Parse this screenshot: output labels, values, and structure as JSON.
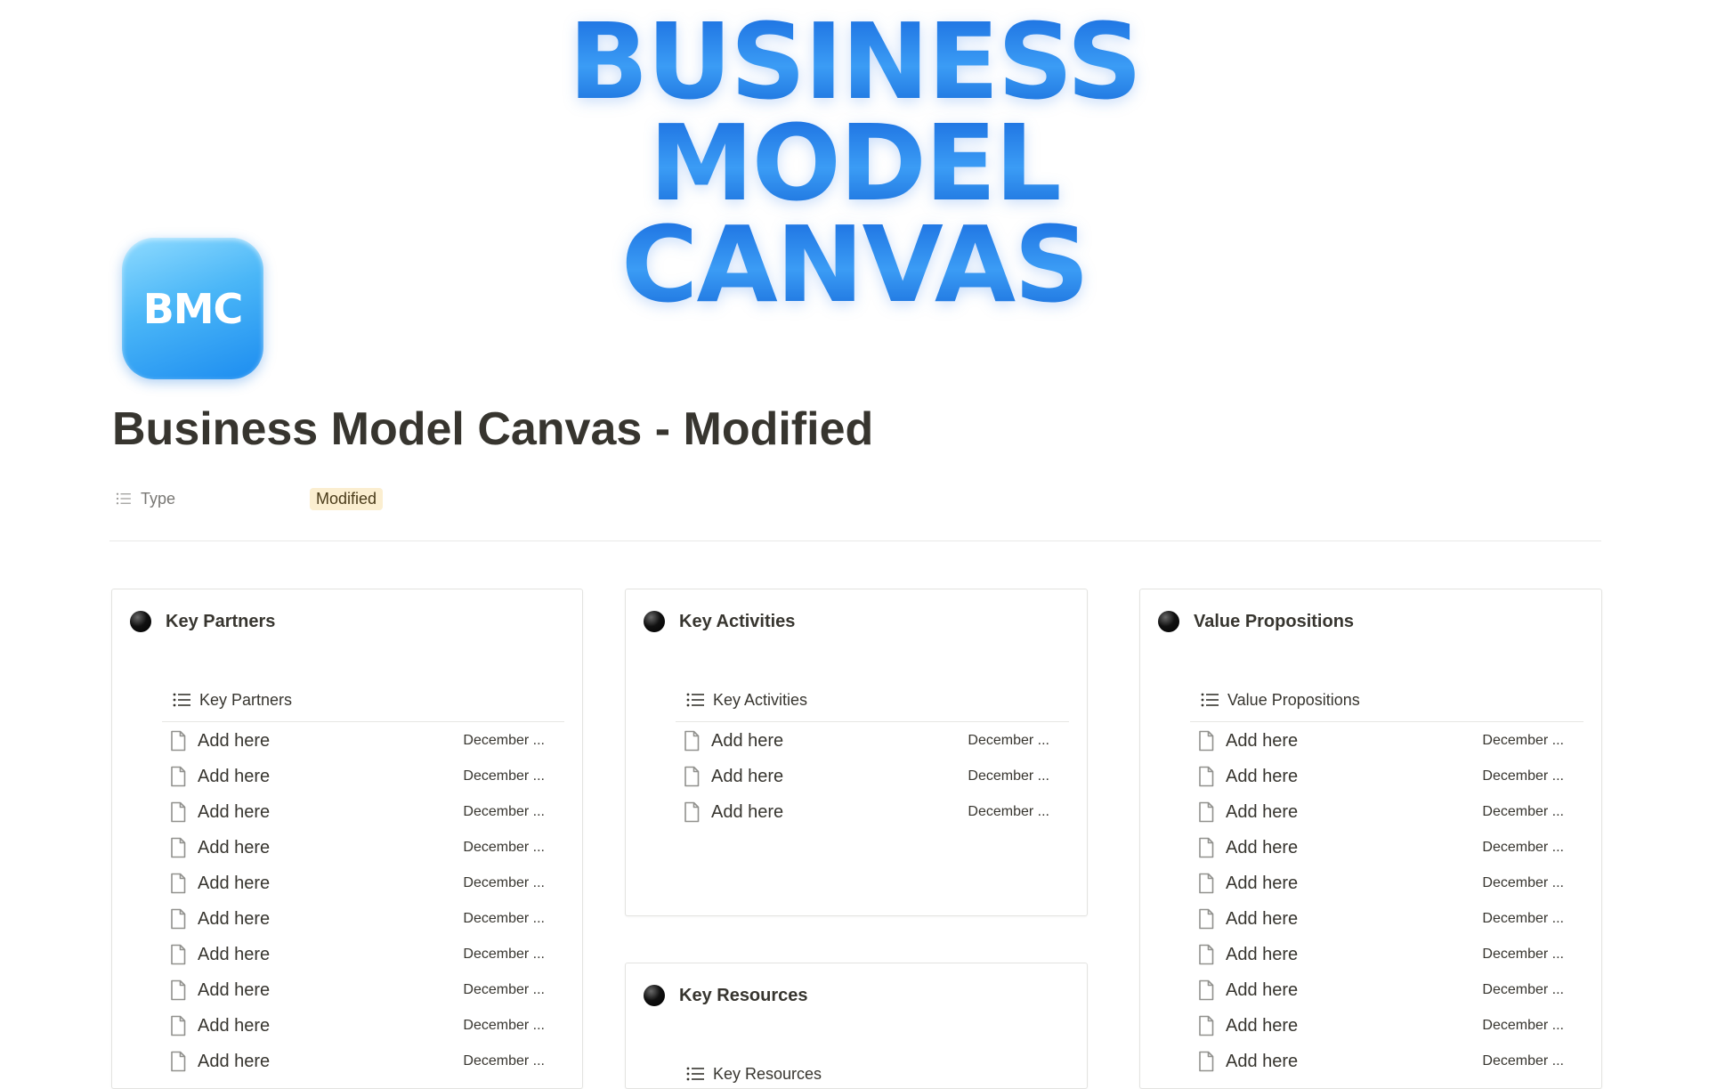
{
  "banner": {
    "lines": [
      "BUSINESS",
      "MODEL",
      "CANVAS"
    ]
  },
  "page_icon": {
    "text": "BMC",
    "icon": "bmc-app-icon"
  },
  "page": {
    "title": "Business Model Canvas - Modified",
    "property": {
      "label": "Type",
      "icon": "list-icon",
      "value": "Modified",
      "tag_color": "#fbeed0"
    }
  },
  "cards": {
    "key_partners": {
      "title": "Key Partners",
      "view": "Key Partners",
      "rows": [
        {
          "title": "Add here",
          "date": "December ..."
        },
        {
          "title": "Add here",
          "date": "December ..."
        },
        {
          "title": "Add here",
          "date": "December ..."
        },
        {
          "title": "Add here",
          "date": "December ..."
        },
        {
          "title": "Add here",
          "date": "December ..."
        },
        {
          "title": "Add here",
          "date": "December ..."
        },
        {
          "title": "Add here",
          "date": "December ..."
        },
        {
          "title": "Add here",
          "date": "December ..."
        },
        {
          "title": "Add here",
          "date": "December ..."
        },
        {
          "title": "Add here",
          "date": "December ..."
        }
      ]
    },
    "key_activities": {
      "title": "Key Activities",
      "view": "Key Activities",
      "rows": [
        {
          "title": "Add here",
          "date": "December ..."
        },
        {
          "title": "Add here",
          "date": "December ..."
        },
        {
          "title": "Add here",
          "date": "December ..."
        }
      ]
    },
    "key_resources": {
      "title": "Key Resources",
      "view": "Key Resources"
    },
    "value_propositions": {
      "title": "Value Propositions",
      "view": "Value Propositions",
      "rows": [
        {
          "title": "Add here",
          "date": "December ..."
        },
        {
          "title": "Add here",
          "date": "December ..."
        },
        {
          "title": "Add here",
          "date": "December ..."
        },
        {
          "title": "Add here",
          "date": "December ..."
        },
        {
          "title": "Add here",
          "date": "December ..."
        },
        {
          "title": "Add here",
          "date": "December ..."
        },
        {
          "title": "Add here",
          "date": "December ..."
        },
        {
          "title": "Add here",
          "date": "December ..."
        },
        {
          "title": "Add here",
          "date": "December ..."
        },
        {
          "title": "Add here",
          "date": "December ..."
        }
      ]
    }
  }
}
